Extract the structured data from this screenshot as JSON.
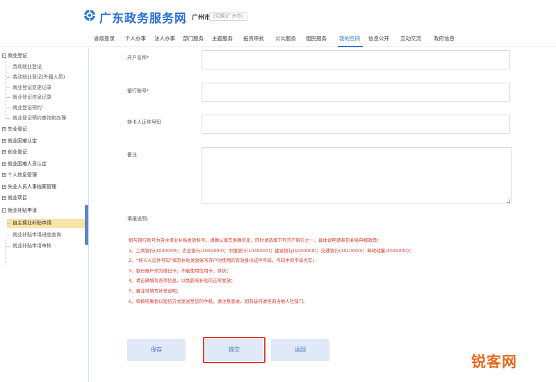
{
  "header": {
    "site_title": "广东政务服务网",
    "city": "广州市",
    "city_switch": "[切换]广州市]",
    "brand_color": "#2a6fd6"
  },
  "nav": {
    "items": [
      {
        "label": "省级登录"
      },
      {
        "label": "个人办事"
      },
      {
        "label": "法人办事"
      },
      {
        "label": "部门服务"
      },
      {
        "label": "主题服务"
      },
      {
        "label": "投资审批"
      },
      {
        "label": "公共服务"
      },
      {
        "label": "便民服务"
      },
      {
        "label": "我的空间"
      },
      {
        "label": "信息公开"
      },
      {
        "label": "互动交流"
      },
      {
        "label": "政府信息"
      }
    ],
    "active_index": 8
  },
  "sidebar": {
    "items": [
      {
        "label": "就业登记",
        "type": "group",
        "expanded": true
      },
      {
        "label": "劳动就业登记",
        "type": "child"
      },
      {
        "label": "劳动就业登记(外籍人员)",
        "type": "child"
      },
      {
        "label": "就业登记变更记录",
        "type": "child"
      },
      {
        "label": "就业登记信息记录",
        "type": "child"
      },
      {
        "label": "就业登记预约",
        "type": "child"
      },
      {
        "label": "就业登记预约查询和办理",
        "type": "child"
      },
      {
        "label": "失业登记",
        "type": "group",
        "expanded": false
      },
      {
        "label": "就业困难认定",
        "type": "group",
        "expanded": false
      },
      {
        "label": "创业登记",
        "type": "group",
        "expanded": false
      },
      {
        "label": "就业困难人员认定",
        "type": "group",
        "expanded": false
      },
      {
        "label": "个人信息管理",
        "type": "group",
        "expanded": false
      },
      {
        "label": "失业人员人事档案管理",
        "type": "group",
        "expanded": false
      },
      {
        "label": "就业项目",
        "type": "group",
        "expanded": false
      },
      {
        "label": "就业补贴申请",
        "type": "group",
        "expanded": true
      },
      {
        "label": "自主择业补贴申请",
        "type": "child",
        "selected": true
      },
      {
        "label": "就业补贴申请进度查询",
        "type": "child"
      },
      {
        "label": "就业补贴申请审核",
        "type": "child"
      }
    ]
  },
  "form": {
    "fields": [
      {
        "label": "开户名称*",
        "value": ""
      },
      {
        "label": "银行账号*",
        "value": ""
      },
      {
        "label": "持卡人证件号码",
        "value": ""
      },
      {
        "label": "备注",
        "value": ""
      }
    ]
  },
  "notes": {
    "title": "填报说明:",
    "lines": [
      "如与银行账号为自主择业补贴发放账号，请确认填写准确信息，同时请选择下列开户银行之一，具体说明请参见补贴申报政策：",
      "1、工商银行(1040000)；农业银行(1050000)；中国银行(1040000)；建设银行(1050000)；交通银行(3010000)；邮政储蓄(4030000)；",
      "2、“持卡人证件号码”填写补贴发放账号开户时使用的有效身份证件号码，号码中的字母大写；",
      "3、银行账户须为借记卡，不能使用信用卡、存折；",
      "4、请正确填写各项信息，以免影响补贴的正常发放；",
      "5、备注可填写补充说明；",
      "6、审核结果会以短信方式发送至您的手机，请注意查收，如有疑问请咨询当地人社部门。"
    ],
    "color": "#d9382c"
  },
  "buttons": {
    "save": "保存",
    "submit": "提交",
    "back": "返回"
  },
  "watermark": "锐客网"
}
